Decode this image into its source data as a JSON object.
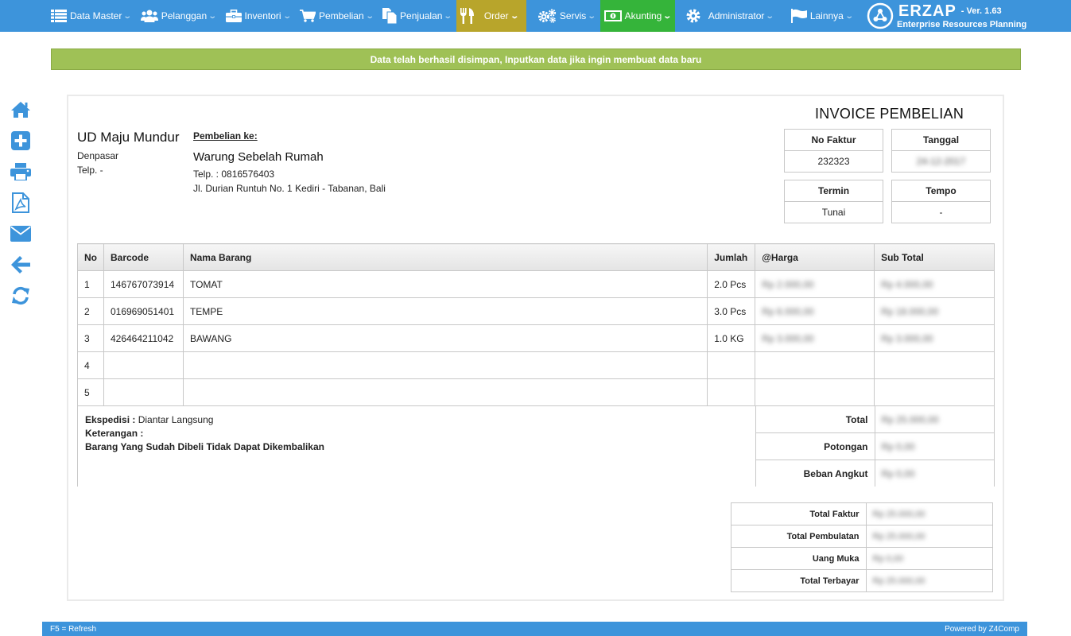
{
  "nav": {
    "items": [
      {
        "label": "Data Master",
        "icon": "list-icon"
      },
      {
        "label": "Pelanggan",
        "icon": "users-icon"
      },
      {
        "label": "Inventori",
        "icon": "briefcase-icon"
      },
      {
        "label": "Pembelian",
        "icon": "cart-icon"
      },
      {
        "label": "Penjualan",
        "icon": "copy-icon"
      },
      {
        "label": "Order",
        "icon": "cutlery-icon"
      },
      {
        "label": "Servis",
        "icon": "gears-icon"
      },
      {
        "label": "Akunting",
        "icon": "money-icon"
      },
      {
        "label": "Administrator",
        "icon": "gear-icon"
      },
      {
        "label": "Lainnya",
        "icon": "flag-icon"
      }
    ],
    "brand": {
      "name": "ERZAP",
      "version": "- Ver. 1.63",
      "subtitle": "Enterprise Resources Planning"
    }
  },
  "alert": {
    "message": "Data telah berhasil disimpan, Inputkan data jika ingin membuat data baru"
  },
  "invoice": {
    "title": "INVOICE PEMBELIAN",
    "company": {
      "name": "UD Maju Mundur",
      "city": "Denpasar",
      "telp": "Telp. -"
    },
    "recipient": {
      "label": "Pembelian ke:",
      "name": "Warung Sebelah Rumah",
      "telp": "Telp. : 0816576403",
      "address": "Jl. Durian Runtuh No. 1 Kediri - Tabanan, Bali"
    },
    "info": {
      "no_faktur_label": "No Faktur",
      "no_faktur": "232323",
      "tanggal_label": "Tanggal",
      "tanggal": "24-12-2017",
      "termin_label": "Termin",
      "termin": "Tunai",
      "tempo_label": "Tempo",
      "tempo": "-"
    },
    "table": {
      "headers": {
        "no": "No",
        "barcode": "Barcode",
        "nama": "Nama Barang",
        "jumlah": "Jumlah",
        "harga": "@Harga",
        "subtotal": "Sub Total"
      },
      "rows": [
        {
          "no": "1",
          "barcode": "146767073914",
          "nama": "TOMAT",
          "jumlah": "2.0 Pcs",
          "harga": "Rp 2.000,00",
          "subtotal": "Rp 4.000,00"
        },
        {
          "no": "2",
          "barcode": "016969051401",
          "nama": "TEMPE",
          "jumlah": "3.0 Pcs",
          "harga": "Rp 6.000,00",
          "subtotal": "Rp 18.000,00"
        },
        {
          "no": "3",
          "barcode": "426464211042",
          "nama": "BAWANG",
          "jumlah": "1.0 KG",
          "harga": "Rp 3.000,00",
          "subtotal": "Rp 3.000,00"
        },
        {
          "no": "4",
          "barcode": "",
          "nama": "",
          "jumlah": "",
          "harga": "",
          "subtotal": ""
        },
        {
          "no": "5",
          "barcode": "",
          "nama": "",
          "jumlah": "",
          "harga": "",
          "subtotal": ""
        }
      ]
    },
    "notes": {
      "ekspedisi_label": "Ekspedisi :",
      "ekspedisi": "Diantar Langsung",
      "keterangan_label": "Keterangan :",
      "policy": "Barang Yang Sudah Dibeli Tidak Dapat Dikembalikan"
    },
    "totals": [
      {
        "label": "Total",
        "value": "Rp 25.000,00"
      },
      {
        "label": "Potongan",
        "value": "Rp 0,00"
      },
      {
        "label": "Beban Angkut",
        "value": "Rp 0,00"
      }
    ],
    "grand": [
      {
        "label": "Total Faktur",
        "value": "Rp 25.000,00"
      },
      {
        "label": "Total Pembulatan",
        "value": "Rp 25.000,00"
      },
      {
        "label": "Uang Muka",
        "value": "Rp 0,00"
      },
      {
        "label": "Total Terbayar",
        "value": "Rp 25.000,00"
      }
    ]
  },
  "statusbar": {
    "left": "F5 = Refresh",
    "right": "Powered by Z4Comp"
  },
  "colors": {
    "nav": "#3d94db",
    "order": "#b8a52b",
    "akunting": "#35b43a",
    "alert": "#9fc156",
    "toolbar_icon": "#3d94db"
  }
}
